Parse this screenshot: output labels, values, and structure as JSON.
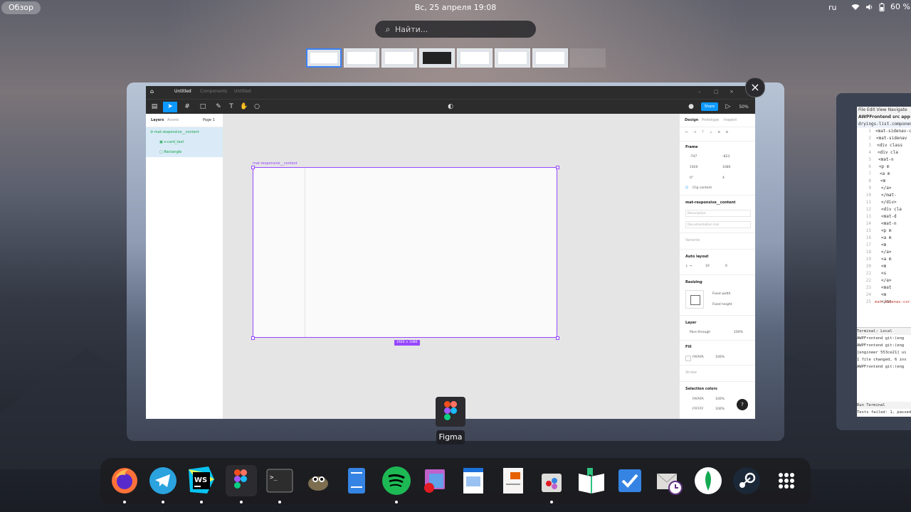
{
  "topbar": {
    "overview": "Обзор",
    "clock": "Вс, 25 апреля  19:08",
    "lang": "ru",
    "battery": "60 %"
  },
  "search": {
    "placeholder": "Найти..."
  },
  "figma": {
    "tabs": [
      "Untitled",
      "Components",
      "Untitled"
    ],
    "toolbar": {
      "share": "Share",
      "zoom": "50%"
    },
    "layers": {
      "tab_layers": "Layers",
      "tab_assets": "Assets",
      "page": "Page 1",
      "items": [
        "mat-responsive__content",
        "v-card_text",
        "Rectangle"
      ]
    },
    "canvas": {
      "frame_label": "mat-responsive__content",
      "size_badge": "1920 × 1080"
    },
    "design": {
      "tab_design": "Design",
      "tab_prototype": "Prototype",
      "tab_inspect": "Inspect",
      "frame_section": "Frame",
      "x": "-747",
      "y": "-823",
      "w": "1920",
      "h": "1080",
      "rotation": "0°",
      "radius": "4",
      "clip": "Clip content",
      "component_name": "mat-responsive__content",
      "description_ph": "Description",
      "doc_ph": "Documentation link",
      "variants": "Variants",
      "auto_layout": "Auto layout",
      "spacing": "10",
      "padding": "0",
      "resizing": "Resizing",
      "fixed_width": "Fixed width",
      "fixed_height": "Fixed height",
      "layer": "Layer",
      "blend": "Pass through",
      "opacity": "100%",
      "fill": "Fill",
      "fill_hex": "FAFAFA",
      "fill_opacity": "100%",
      "stroke": "Stroke",
      "selection_colors": "Selection colors",
      "sel1_hex": "FAFAFA",
      "sel1_op": "100%",
      "sel2_hex": "FFFFFF",
      "sel2_op": "100%",
      "help": "?"
    }
  },
  "app_label": "Figma",
  "ide": {
    "menu": "File  Edit  View  Navigate",
    "crumbs": "AWPFrontend  src  app",
    "file": "dryings-list.component",
    "lines": [
      "<mat-sidenav-co",
      "<mat-sidenav",
      "<div class",
      "<div cla",
      "<mat-n",
      "<p m",
      "<a m",
      "<m",
      "</a>",
      "</mat-",
      "</div>",
      "<div cla",
      "<mat-d",
      "<mat-n",
      "<p m",
      "<a m",
      "<m",
      "</a>",
      "<a m",
      "<m",
      "<s",
      "</a>",
      "<mat",
      "<m",
      "</mo"
    ],
    "line_numbers": [
      "1",
      "2",
      "3",
      "4",
      "5",
      "6",
      "7",
      "8",
      "9",
      "10",
      "11",
      "12",
      "13",
      "14",
      "15",
      "16",
      "17",
      "18",
      "19",
      "20",
      "21",
      "22",
      "23",
      "24",
      "25"
    ],
    "footer_tag": "mat-sidenav-cor",
    "terminal_tabs": "Terminal:  Local",
    "terminal_lines": [
      "AWPFrontend git:(eng",
      "AWPFrontend git:(eng",
      "[engineer 553ce21] ui",
      " 1 file changed, 6 ins",
      "AWPFrontend git:(eng"
    ],
    "run_tabs": "Run   Terminal",
    "status": "Tests failed: 1, passed: 7"
  },
  "dock_apps": [
    "firefox-icon",
    "telegram-icon",
    "webstorm-icon",
    "figma-icon",
    "terminal-icon",
    "gimp-icon",
    "files-icon",
    "spotify-icon",
    "photo-editor-icon",
    "writer-icon",
    "impress-icon",
    "software-icon",
    "reader-icon",
    "tasks-icon",
    "mail-clock-icon",
    "mongodb-icon",
    "steam-icon",
    "app-grid-icon"
  ],
  "colors": {
    "accent": "#0d99ff",
    "frame_select": "#9747ff",
    "layer_green": "#17a34a"
  }
}
